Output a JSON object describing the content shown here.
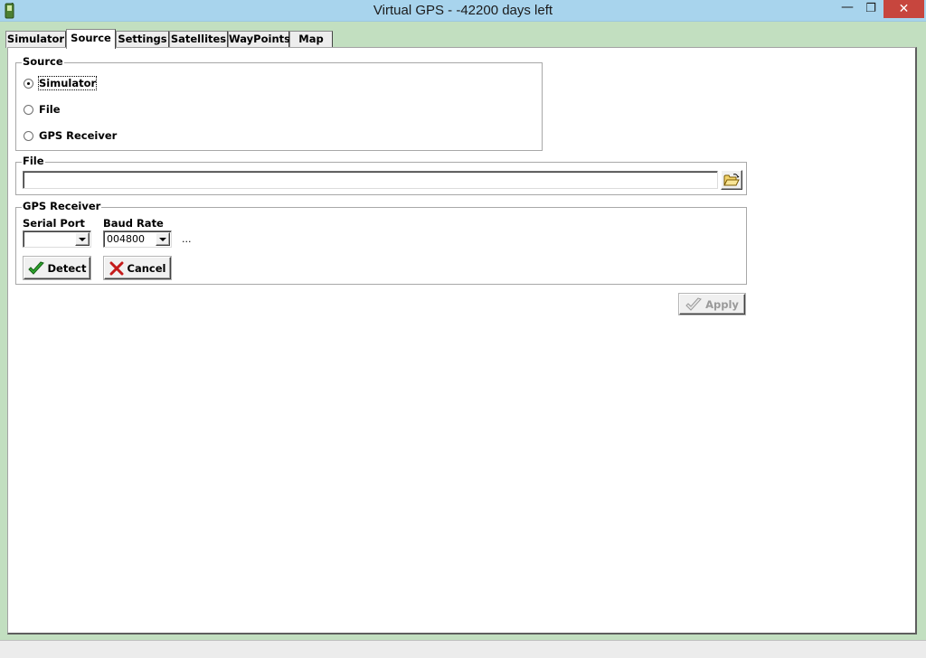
{
  "window": {
    "title": "Virtual GPS - -42200 days left",
    "minimize_glyph": "—",
    "maximize_glyph": "❐",
    "close_glyph": "✕"
  },
  "tabs": [
    {
      "label": "Simulator",
      "active": false
    },
    {
      "label": "Source",
      "active": true
    },
    {
      "label": "Settings",
      "active": false
    },
    {
      "label": "Satellites",
      "active": false
    },
    {
      "label": "WayPoints",
      "active": false
    },
    {
      "label": "Map",
      "active": false
    }
  ],
  "source_group": {
    "title": "Source",
    "options": [
      {
        "label": "Simulator",
        "checked": true
      },
      {
        "label": "File",
        "checked": false
      },
      {
        "label": "GPS Receiver",
        "checked": false
      }
    ]
  },
  "file_group": {
    "title": "File",
    "path_value": "",
    "browse_icon": "open-folder-icon"
  },
  "gps_group": {
    "title": "GPS Receiver",
    "serial_port_label": "Serial Port",
    "serial_port_value": "",
    "baud_rate_label": "Baud Rate",
    "baud_rate_value": "004800",
    "ellipsis": "...",
    "detect_label": "Detect",
    "cancel_label": "Cancel"
  },
  "apply_label": "Apply",
  "colors": {
    "titlebar": "#a8d4ed",
    "close_button": "#c7463e",
    "window_background": "#c2dfc0"
  }
}
